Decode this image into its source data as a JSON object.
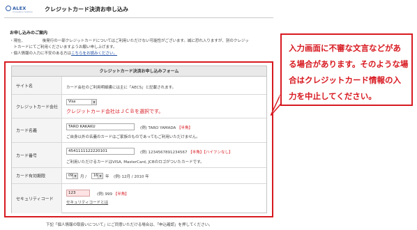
{
  "header": {
    "logo_text": "ALEX",
    "logo_tagline": "Innovation Solution",
    "title": "クレジットカード決済お申し込み"
  },
  "notice": {
    "title": "お申し込みのご案内",
    "line1": "・現在、　　　　　後発行の一部クレジットカードについてはご利用いただけない可能性がございます。誠に恐れ入りますが、別のクレジッ",
    "line2": "　トカードにてご利用くださいますようお願い申し上げます。",
    "line3_prefix": "・個人情報の入力に不安のある方は",
    "line3_link": "こちらをお読みください。"
  },
  "form": {
    "title": "クレジットカード決済お申し込みフォーム",
    "site_name": {
      "label": "サイト名",
      "text": "カード会社のご利用明細書には主に「AECS」と記載されます。"
    },
    "card_company": {
      "label": "クレジットカード会社",
      "selected": "Visa",
      "warning": "クレジットカード会社はＪＣＢを選択です。"
    },
    "card_name": {
      "label": "カード名義",
      "value": "TARO KAKAKU",
      "example": "(例) TARO YAMADA",
      "badge": "【半角】",
      "note": "ご自身以外の名義のカードはご家族のものであってもご利用いただけません。"
    },
    "card_number": {
      "label": "カード番号",
      "value": "4541111122220101",
      "example": "(例) 1234567891234567",
      "badge": "【半角】【ハイフンなし】",
      "note": "ご利用いただけるカードはVISA, MasterCard, JCBのロゴがついたカードです。"
    },
    "expiry": {
      "label": "カード有効期限",
      "month": "09",
      "month_unit": "月 /",
      "year": "16",
      "year_unit": "年",
      "example": "(例) 12月 / 2010 年"
    },
    "security_code": {
      "label": "セキュリティコード",
      "value": "123",
      "example": "(例) 999",
      "badge": "【半角】",
      "link": "セキュリティコードとは"
    }
  },
  "footer_note": "下記「個人情報の取扱いについて」にご同意いただける場合は、「申込確認」を押してください。",
  "callout": {
    "text": "入力画面に不審な文言などがある場合があります。そのような場合はクレジットカード情報の入力を中止してください。"
  },
  "colors": {
    "accent_red": "#d71920",
    "link_blue": "#1f4ea3",
    "logo_blue": "#2a5aa8"
  }
}
